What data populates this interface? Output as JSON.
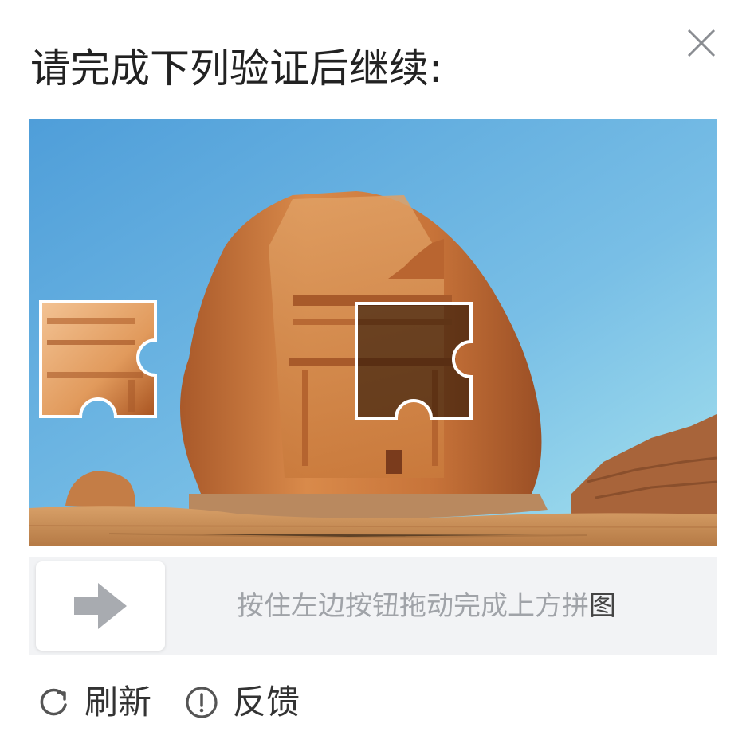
{
  "dialog": {
    "title": "请完成下列验证后继续:",
    "close_icon": "close-icon"
  },
  "captcha": {
    "type": "slider-puzzle",
    "hint_main": "按住左边按钮拖动完成上方拼",
    "hint_last_char": "图",
    "handle_icon": "arrow-right-icon"
  },
  "footer": {
    "refresh_label": "刷新",
    "refresh_icon": "refresh-icon",
    "feedback_label": "反馈",
    "feedback_icon": "info-circle-icon"
  },
  "colors": {
    "sky_top": "#5aa7dd",
    "sky_bottom": "#9bdcf0",
    "rock": "#c9743a",
    "sand": "#c98f52",
    "track": "#f2f3f5",
    "hint_text": "#a0a3a8"
  }
}
